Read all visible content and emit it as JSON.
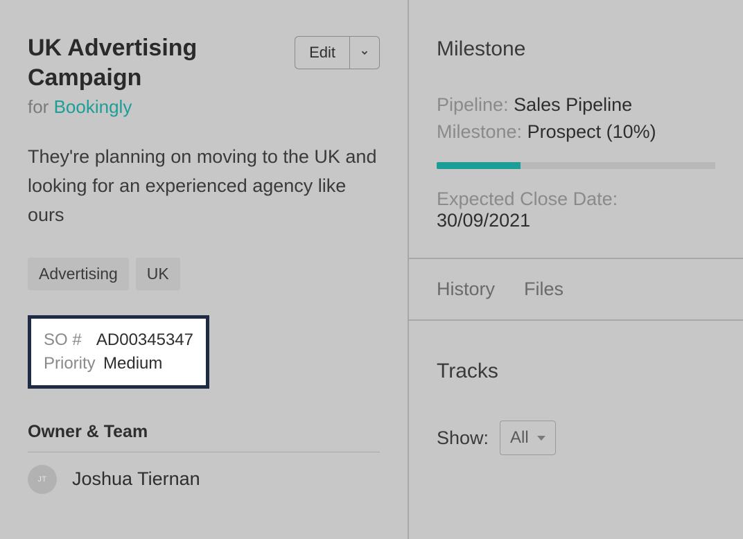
{
  "left": {
    "title": "UK Advertising Campaign",
    "for_prefix": "for ",
    "company": "Bookingly",
    "edit_label": "Edit",
    "description": "They're planning on moving to the UK and looking for an experienced agency like ours",
    "tags": [
      "Advertising",
      "UK"
    ],
    "highlight": {
      "so_label": "SO #",
      "so_value": "AD00345347",
      "priority_label": "Priority",
      "priority_value": "Medium"
    },
    "owner_team_heading": "Owner & Team",
    "owner_initials": "JT",
    "owner_name": "Joshua Tiernan"
  },
  "right": {
    "milestone_heading": "Milestone",
    "pipeline_label": "Pipeline: ",
    "pipeline_value": "Sales Pipeline",
    "milestone_label": "Milestone: ",
    "milestone_value": "Prospect (10%)",
    "expected_close_label": "Expected Close Date: ",
    "expected_close_value": "30/09/2021",
    "tabs": {
      "history": "History",
      "files": "Files"
    },
    "tracks_heading": "Tracks",
    "show_label": "Show:",
    "show_value": "All"
  }
}
